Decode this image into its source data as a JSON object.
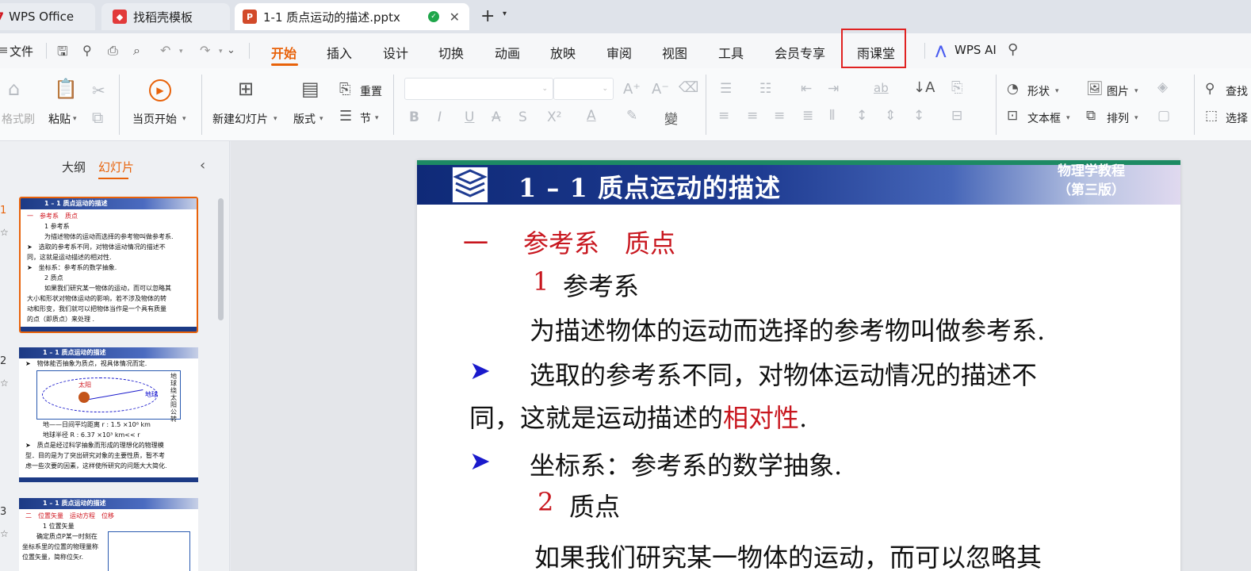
{
  "tabs": [
    {
      "label": "WPS Office",
      "icon": "wps-logo-icon"
    },
    {
      "label": "找稻壳模板",
      "icon": "docer-icon"
    },
    {
      "label": "1-1 质点运动的描述.pptx",
      "icon": "ppt-file-icon",
      "active": true
    }
  ],
  "menu": {
    "file": "文件",
    "items": [
      "开始",
      "插入",
      "设计",
      "切换",
      "动画",
      "放映",
      "审阅",
      "视图",
      "工具",
      "会员专享",
      "雨课堂"
    ],
    "active": "开始",
    "wps_ai": "WPS AI"
  },
  "ribbon": {
    "format_painter": "格式刷",
    "paste": "粘贴",
    "play_from_current": "当页开始",
    "new_slide": "新建幻灯片",
    "layout": "版式",
    "reset": "重置",
    "section": "节",
    "shape": "形状",
    "picture": "图片",
    "textbox": "文本框",
    "arrange": "排列",
    "find": "查找",
    "select": "选择"
  },
  "left_panel": {
    "tab_outline": "大纲",
    "tab_slides": "幻灯片",
    "slides": [
      {
        "num": "1",
        "title": "1 – 1 质点运动的描述",
        "lines": [
          "一　参考系　质点",
          "1 参考系",
          "为描述物体的运动而选择的参考物叫做参考系.",
          "➤　选取的参考系不同，对物体运动情况的描述不",
          "同，这就是运动描述的相对性.",
          "➤　坐标系：参考系的数学抽象.",
          "2 质点",
          "如果我们研究某一物体的运动，而可以忽略其",
          "大小和形状对物体运动的影响，若不涉及物体的转",
          "动和形变，我们就可以把物体当作是一个具有质量",
          "的点（即质点）来处理 ."
        ]
      },
      {
        "num": "2",
        "title": "1 – 1 质点运动的描述",
        "lines": [
          "➤　物体能否抽象为质点，视具体情况而定.",
          "太阳",
          "地球",
          "地球绕太阳公转",
          "地——日间平均距离 r : 1.5 ×10⁸ km",
          "地球半径 R : 6.37 ×10³ km<< r",
          "➤　质点是经过科学抽象而形成的理想化的物理模",
          "型．目的是为了突出研究对象的主要性质，暂不考",
          "虑一些次要的因素，这样使所研究的问题大大简化."
        ]
      },
      {
        "num": "3",
        "title": "1 – 1 质点运动的描述",
        "lines": [
          "二　位置矢量　运动方程　位移",
          "1 位置矢量",
          "确定质点P某一时刻在",
          "坐标系里的位置的物理量称",
          "位置矢量，简称位矢r."
        ]
      }
    ]
  },
  "slide": {
    "banner_title": "1 – 1 质点运动的描述",
    "banner_right_1": "物理学教程",
    "banner_right_2": "（第三版）",
    "heading_num": "一",
    "heading": "参考系　质点",
    "sub1_num": "1",
    "sub1": "参考系",
    "line1": "为描述物体的运动而选择的参考物叫做参考系.",
    "bullet1_a": "选取的参考系不同，对物体运动情况的描述不",
    "bullet1_b_pre": "同，这就是运动描述的",
    "bullet1_b_red": "相对性",
    "bullet1_b_post": ".",
    "bullet2": "坐标系：参考系的数学抽象.",
    "sub2_num": "2",
    "sub2": "质点",
    "line_last": "如果我们研究某一物体的运动，而可以忽略其"
  },
  "colors": {
    "accent": "#e8620a",
    "highlight": "#e02222",
    "slide_red": "#c8161e",
    "slide_blue": "#1a1acc"
  }
}
